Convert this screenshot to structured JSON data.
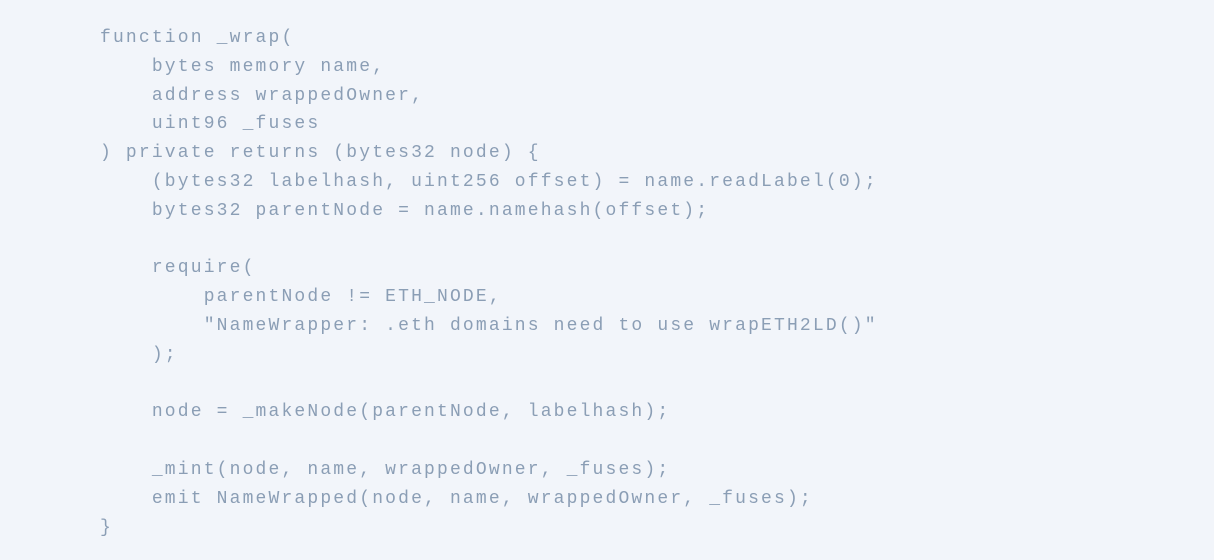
{
  "code_lines": [
    "function _wrap(",
    "    bytes memory name,",
    "    address wrappedOwner,",
    "    uint96 _fuses",
    ") private returns (bytes32 node) {",
    "    (bytes32 labelhash, uint256 offset) = name.readLabel(0);",
    "    bytes32 parentNode = name.namehash(offset);",
    "",
    "    require(",
    "        parentNode != ETH_NODE,",
    "        \"NameWrapper: .eth domains need to use wrapETH2LD()\"",
    "    );",
    "",
    "    node = _makeNode(parentNode, labelhash);",
    "",
    "    _mint(node, name, wrappedOwner, _fuses);",
    "    emit NameWrapped(node, name, wrappedOwner, _fuses);",
    "}"
  ]
}
